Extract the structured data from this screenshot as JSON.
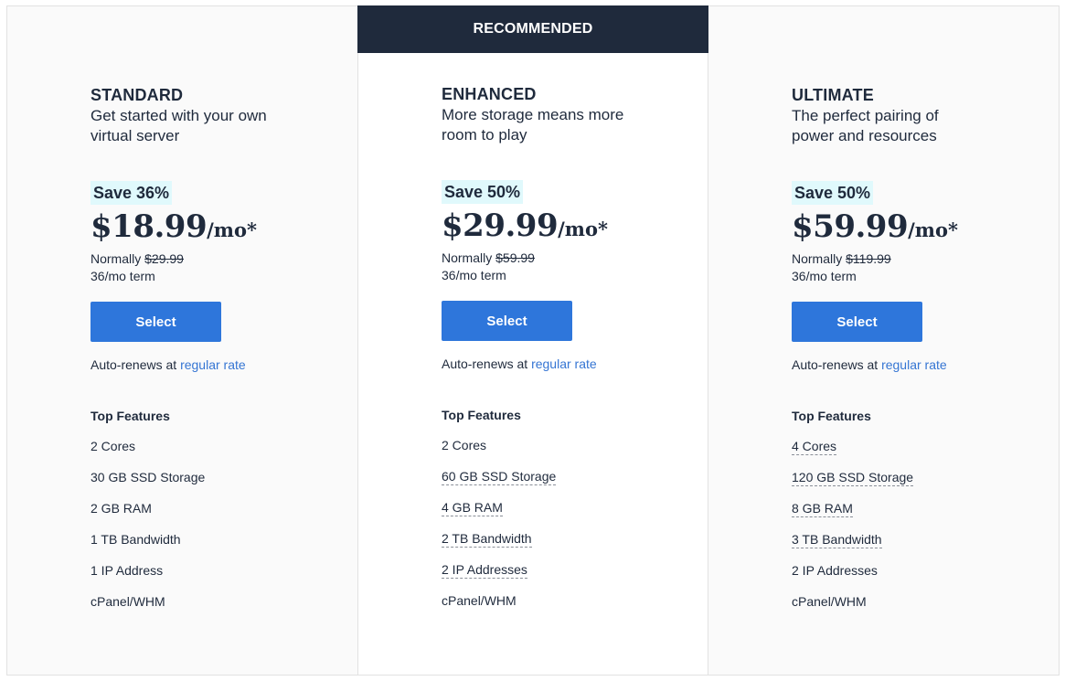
{
  "ribbon_label": "RECOMMENDED",
  "plans": [
    {
      "name": "STANDARD",
      "tagline": "Get started with your own virtual server",
      "save": "Save 36%",
      "price": "$18.99",
      "per": "/mo*",
      "normally_label": "Normally",
      "normal_price": "$29.99",
      "term": "36/mo term",
      "select_label": "Select",
      "renew_text": "Auto-renews at",
      "renew_link": "regular rate",
      "features_title": "Top Features",
      "features": [
        {
          "text": "2 Cores",
          "tooltip": false
        },
        {
          "text": "30 GB SSD Storage",
          "tooltip": false
        },
        {
          "text": "2 GB RAM",
          "tooltip": false
        },
        {
          "text": "1 TB Bandwidth",
          "tooltip": false
        },
        {
          "text": "1 IP Address",
          "tooltip": false
        },
        {
          "text": "cPanel/WHM",
          "tooltip": false
        }
      ]
    },
    {
      "name": "ENHANCED",
      "tagline": "More storage means more room to play",
      "save": "Save 50%",
      "price": "$29.99",
      "per": "/mo*",
      "normally_label": "Normally",
      "normal_price": "$59.99",
      "term": "36/mo term",
      "select_label": "Select",
      "renew_text": "Auto-renews at",
      "renew_link": "regular rate",
      "features_title": "Top Features",
      "features": [
        {
          "text": "2 Cores",
          "tooltip": false
        },
        {
          "text": "60 GB SSD Storage",
          "tooltip": true
        },
        {
          "text": "4 GB RAM",
          "tooltip": true
        },
        {
          "text": "2 TB Bandwidth",
          "tooltip": true
        },
        {
          "text": "2 IP Addresses",
          "tooltip": true
        },
        {
          "text": "cPanel/WHM",
          "tooltip": false
        }
      ]
    },
    {
      "name": "ULTIMATE",
      "tagline": "The perfect pairing of power and resources",
      "save": "Save 50%",
      "price": "$59.99",
      "per": "/mo*",
      "normally_label": "Normally",
      "normal_price": "$119.99",
      "term": "36/mo term",
      "select_label": "Select",
      "renew_text": "Auto-renews at",
      "renew_link": "regular rate",
      "features_title": "Top Features",
      "features": [
        {
          "text": "4 Cores",
          "tooltip": true
        },
        {
          "text": "120 GB SSD Storage",
          "tooltip": true
        },
        {
          "text": "8 GB RAM",
          "tooltip": true
        },
        {
          "text": "3 TB Bandwidth",
          "tooltip": true
        },
        {
          "text": "2 IP Addresses",
          "tooltip": false
        },
        {
          "text": "cPanel/WHM",
          "tooltip": false
        }
      ]
    }
  ],
  "colors": {
    "ribbon_bg": "#1f2a3c",
    "button_bg": "#2e76db",
    "save_bg": "#e0f9fc",
    "link": "#3575d3",
    "text": "#1f2a3c"
  }
}
